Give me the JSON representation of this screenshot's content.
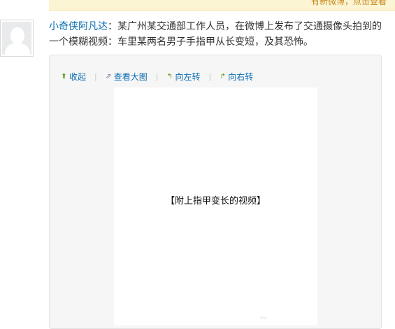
{
  "notice": {
    "text": "有新微博，点击查看"
  },
  "post": {
    "author": "小奇侠阿凡达",
    "colon": "：",
    "text": "某广州某交通部工作人员，在微博上发布了交通摄像头拍到的一个模糊视频：车里某两名男子手指甲从长变短，及其恐怖。"
  },
  "toolbar": {
    "items": [
      {
        "icon": "collapse-icon",
        "label": "收起"
      },
      {
        "icon": "view-large-icon",
        "label": "查看大图"
      },
      {
        "icon": "rotate-left-icon",
        "label": "向左转"
      },
      {
        "icon": "rotate-right-icon",
        "label": "向右转"
      }
    ],
    "separator": "|"
  },
  "image": {
    "caption": "【附上指甲变长的视频】"
  },
  "colors": {
    "link": "#0a6cb0",
    "notice_bg": "#fcf5d4",
    "notice_text": "#c58a1e"
  }
}
